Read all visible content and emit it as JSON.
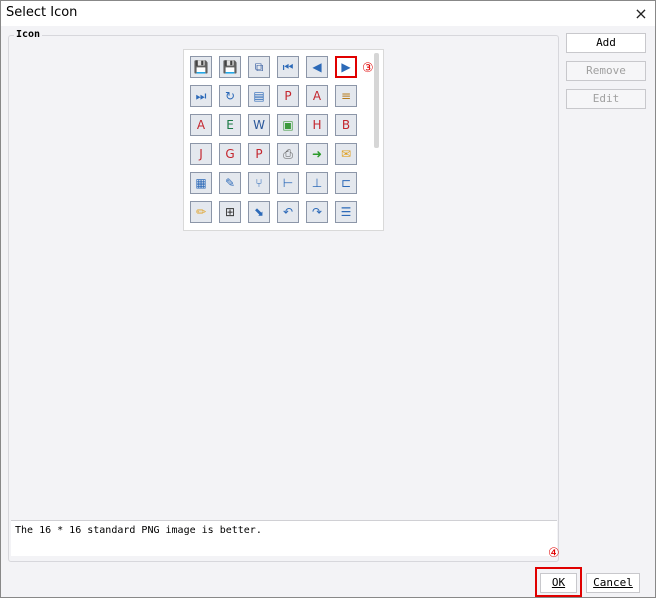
{
  "window": {
    "title": "Select Icon",
    "close_glyph": "×"
  },
  "group": {
    "label": "Icon"
  },
  "icons": [
    {
      "name": "save-icon",
      "glyph": "💾",
      "color": "#3a5fa0"
    },
    {
      "name": "save-as-icon",
      "glyph": "💾",
      "color": "#3a5fa0"
    },
    {
      "name": "copy-window-icon",
      "glyph": "⧉",
      "color": "#3a5fa0"
    },
    {
      "name": "first-record-icon",
      "glyph": "⏮",
      "color": "#2d6ab8"
    },
    {
      "name": "previous-record-icon",
      "glyph": "◀",
      "color": "#2d6ab8"
    },
    {
      "name": "next-record-icon",
      "glyph": "▶",
      "color": "#2d6ab8"
    },
    {
      "name": "last-record-icon",
      "glyph": "⏭",
      "color": "#2d6ab8"
    },
    {
      "name": "refresh-icon",
      "glyph": "↻",
      "color": "#2d6ab8"
    },
    {
      "name": "book-icon",
      "glyph": "▤",
      "color": "#2d6ab8"
    },
    {
      "name": "pdf-export-icon",
      "glyph": "P",
      "color": "#c4262e"
    },
    {
      "name": "acrobat-icon",
      "glyph": "A",
      "color": "#c4262e"
    },
    {
      "name": "document-chart-icon",
      "glyph": "≡",
      "color": "#b87b1a"
    },
    {
      "name": "acrobat-red-icon",
      "glyph": "A",
      "color": "#c4262e"
    },
    {
      "name": "excel-icon",
      "glyph": "E",
      "color": "#1a7a45"
    },
    {
      "name": "word-icon",
      "glyph": "W",
      "color": "#2b579a"
    },
    {
      "name": "image-icon",
      "glyph": "▣",
      "color": "#3c9a3c"
    },
    {
      "name": "html-icon",
      "glyph": "H",
      "color": "#c4262e"
    },
    {
      "name": "bmp-icon",
      "glyph": "B",
      "color": "#c4262e"
    },
    {
      "name": "jpg-icon",
      "glyph": "J",
      "color": "#c4262e"
    },
    {
      "name": "gif-icon",
      "glyph": "G",
      "color": "#c4262e"
    },
    {
      "name": "png-icon",
      "glyph": "P",
      "color": "#c4262e"
    },
    {
      "name": "printer-icon",
      "glyph": "⎙",
      "color": "#555555"
    },
    {
      "name": "export-icon",
      "glyph": "➜",
      "color": "#2a9a2a"
    },
    {
      "name": "email-icon",
      "glyph": "✉",
      "color": "#e0a020"
    },
    {
      "name": "form-icon",
      "glyph": "▦",
      "color": "#2d6ab8"
    },
    {
      "name": "edit-form-icon",
      "glyph": "✎",
      "color": "#2d6ab8"
    },
    {
      "name": "tree-icon",
      "glyph": "⑂",
      "color": "#2d6ab8"
    },
    {
      "name": "branch-icon",
      "glyph": "⊢",
      "color": "#2d6ab8"
    },
    {
      "name": "hierarchy-icon",
      "glyph": "⊥",
      "color": "#2d6ab8"
    },
    {
      "name": "flow-icon",
      "glyph": "⊏",
      "color": "#2d6ab8"
    },
    {
      "name": "draw-icon",
      "glyph": "✏",
      "color": "#e0a020"
    },
    {
      "name": "insert-icon",
      "glyph": "⊞",
      "color": "#333333"
    },
    {
      "name": "clear-icon",
      "glyph": "⬊",
      "color": "#2d6ab8"
    },
    {
      "name": "undo-icon",
      "glyph": "↶",
      "color": "#2d6ab8"
    },
    {
      "name": "redo-icon",
      "glyph": "↷",
      "color": "#2d6ab8"
    },
    {
      "name": "list-icon",
      "glyph": "☰",
      "color": "#2d6ab8"
    }
  ],
  "selected_icon": "next-record-icon",
  "markers": {
    "selected_icon": "③",
    "ok": "④"
  },
  "side_buttons": {
    "add": "Add",
    "remove": "Remove",
    "edit": "Edit"
  },
  "hint_text": "The 16 * 16 standard PNG image is better.",
  "footer": {
    "ok": "OK",
    "cancel": "Cancel"
  },
  "colors": {
    "highlight": "#e00000"
  }
}
